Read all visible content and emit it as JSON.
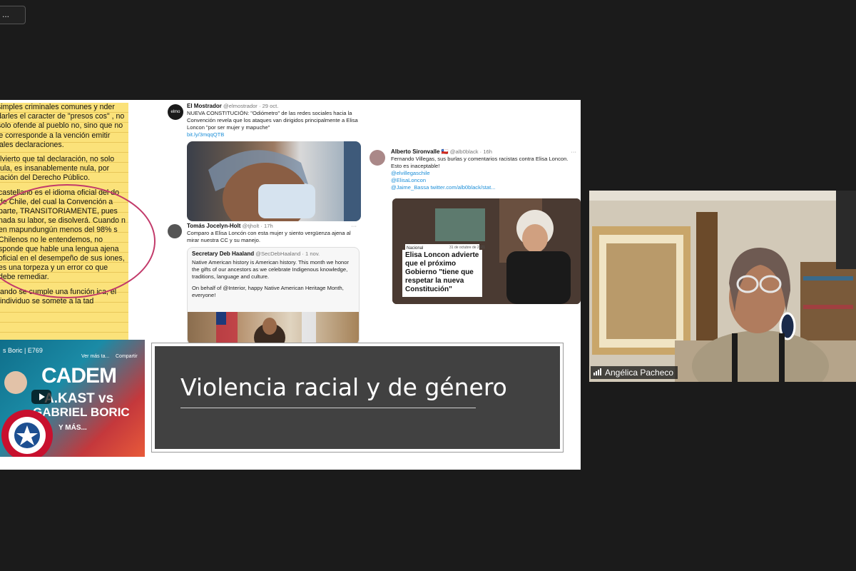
{
  "toolbar": {
    "menu_label": "..."
  },
  "slide": {
    "legal_text": [
      "simples criminales comunes y nder darles el caracter de \"presos cos\" , no solo ofende al pueblo no, sino que no le corresponde a la vención emitir tales declaraciones.",
      "lvierto que tal declaración, no solo ula, es insanablemente nula, por ación del Derecho Público.",
      "castellano es el idioma oficial del do de Chile, del cual la Convención a parte, TRANSITORIAMENTE, pues nada su labor, se disolverá. Cuando n en mapundungún menos del 98% s Chilenos no le entendemos, no sponde que hable una lengua ajena oficial en el desempeño de sus iones, es una torpeza y un error co que debe remediar.",
      "ando se cumple una función ica, el individuo se somete a la tad"
    ],
    "tweet1": {
      "avatar": "elmo",
      "name": "El Mostrador",
      "handle": "@elmostrador · 29 oct.",
      "text": "NUEVA CONSTITUCIÓN: \"Odiómetro\" de las redes sociales hacia la Convención revela que los ataques van dirigidos principalmente a Elisa Loncon \"por ser mujer y mapuche\"",
      "link": "bit.ly/3mqqQTB"
    },
    "tweet2": {
      "name": "Tomás Jocelyn-Holt",
      "handle": "@tjholt · 17h",
      "text": "Comparo a Elisa Loncón con esta mujer y siento vergüenza ajena al mirar nuestra CC y su manejo.",
      "menu": "···"
    },
    "quote": {
      "name": "Secretary Deb Haaland",
      "handle": "@SecDebHaaland · 1 nov.",
      "text": "Native American history is American history. This month we honor the gifts of our ancestors as we celebrate Indigenous knowledge, traditions, language and culture.",
      "text2": "On behalf of @Interior, happy Native American Heritage Month, everyone!"
    },
    "tweet3": {
      "name": "Alberto Sironvalle 🇨🇱",
      "handle": "@alb0black · 16h",
      "text": "Fernando Villegas, sus burlas y comentarios racistas contra Elisa Loncon. Esto es inaceptable!",
      "links": [
        "@elvillegaschile",
        "@ElisaLoncon",
        "@Jaime_Bassa twitter.com/alb0black/stat..."
      ],
      "menu": "···"
    },
    "news": {
      "source": "Nacional",
      "date": "31 de octubre de 2021",
      "headline": "Elisa Loncon advierte que el próximo Gobierno \"tiene que respetar la nueva Constitución\""
    },
    "video": {
      "title": "s Boric | E769",
      "watch_later": "Ver más ta...",
      "share": "Compartir",
      "line1": "CADEM",
      "line2": "A.KAST vs",
      "line3": "GABRIEL BORIC",
      "line4": "Y MÁS..."
    },
    "title": "Violencia racial y de género"
  },
  "participant": {
    "name": "Angélica Pacheco"
  },
  "colors": {
    "background": "#1b1b1b",
    "slide_title_bg": "#414141",
    "legal_pad": "#fbe27a",
    "circle": "#c23a6a"
  }
}
